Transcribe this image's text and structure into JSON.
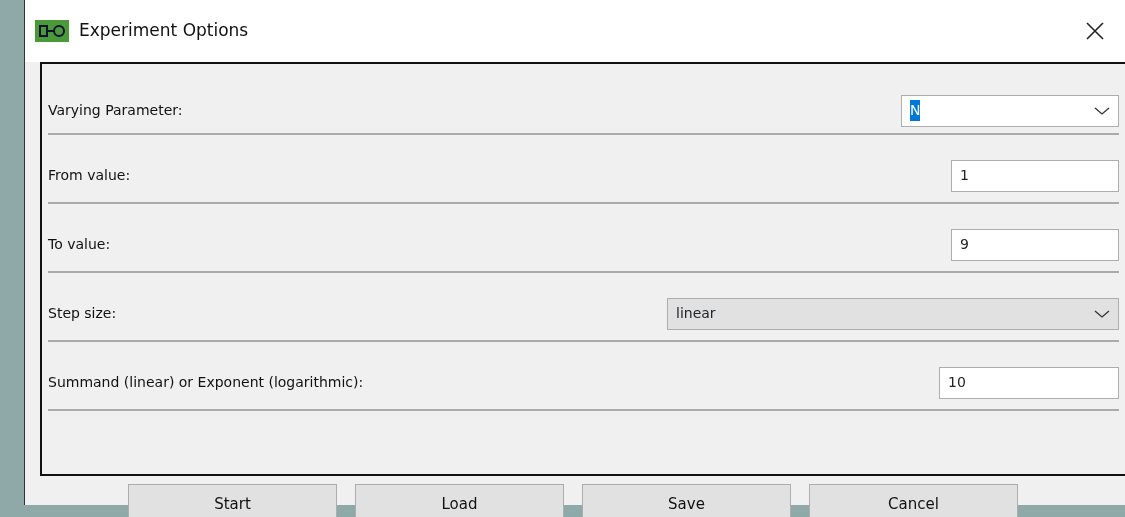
{
  "window": {
    "title": "Experiment Options"
  },
  "fields": [
    {
      "label": "Varying Parameter:",
      "kind": "editable-combo",
      "value": "N"
    },
    {
      "label": "From value:",
      "kind": "text",
      "value": "1"
    },
    {
      "label": "To value:",
      "kind": "text",
      "value": "9"
    },
    {
      "label": "Step size:",
      "kind": "combo",
      "value": "linear"
    },
    {
      "label": "Summand (linear) or Exponent (logarithmic):",
      "kind": "text",
      "value": "10"
    }
  ],
  "buttons": [
    "Start",
    "Load",
    "Save",
    "Cancel"
  ]
}
